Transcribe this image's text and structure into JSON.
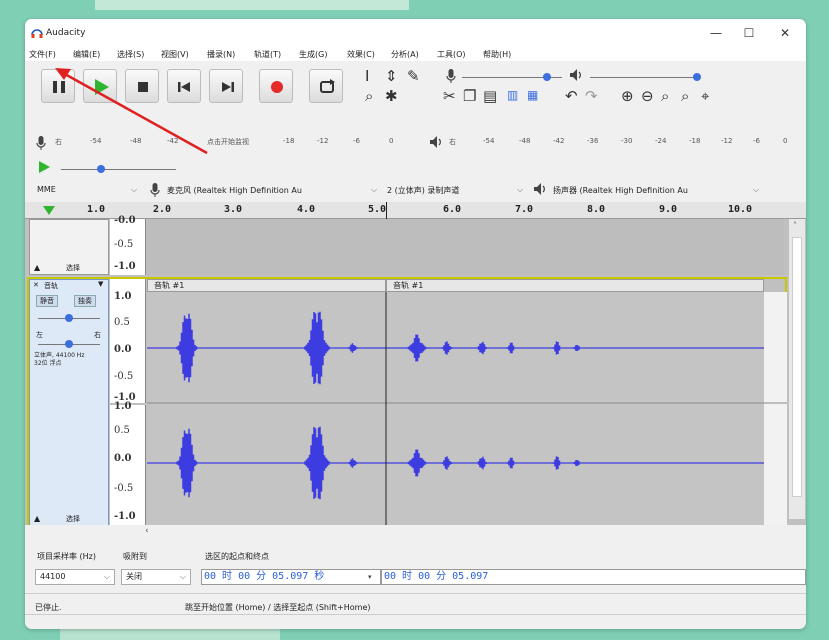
{
  "window": {
    "title": "Audacity",
    "minimize": "—",
    "maximize": "☐",
    "close": "✕"
  },
  "menu": [
    {
      "label": "文件(F)"
    },
    {
      "label": "编辑(E)"
    },
    {
      "label": "选择(S)"
    },
    {
      "label": "视图(V)"
    },
    {
      "label": "播录(N)"
    },
    {
      "label": "轨道(T)"
    },
    {
      "label": "生成(G)"
    },
    {
      "label": "效果(C)"
    },
    {
      "label": "分析(A)"
    },
    {
      "label": "工具(O)"
    },
    {
      "label": "帮助(H)"
    }
  ],
  "transport": {
    "pause_icon": "pause-icon",
    "play_icon": "play-icon",
    "stop_icon": "stop-icon",
    "skip_start_icon": "skip-start-icon",
    "skip_end_icon": "skip-end-icon",
    "record_icon": "record-icon",
    "loop_icon": "loop-icon",
    "record_color": "#e52a2a",
    "play_color": "#2fb52f"
  },
  "meters": {
    "record_scale": [
      "右",
      "-54",
      "-48",
      "-42",
      "点击开始监视",
      "-18",
      "-12",
      "-6",
      "0"
    ],
    "play_scale": [
      "右",
      "-54",
      "-48",
      "-42",
      "-36",
      "-30",
      "-24",
      "-18",
      "-12",
      "-6",
      "0"
    ]
  },
  "device": {
    "host": "MME",
    "mic": "麦克风 (Realtek High Definition Au",
    "channels": "2 (立体声) 录制声道",
    "speaker": "扬声器 (Realtek High Definition Au"
  },
  "ruler": {
    "labels": [
      "1.0",
      "2.0",
      "3.0",
      "4.0",
      "5.0",
      "6.0",
      "7.0",
      "8.0",
      "9.0",
      "10.0"
    ]
  },
  "track1": {
    "scale": [
      "-0.0",
      "-0.5",
      "-1.0"
    ],
    "select_label": "选择"
  },
  "track2": {
    "name": "音轨",
    "mute": "静音",
    "solo": "独奏",
    "pan_left": "左",
    "pan_right": "右",
    "info": "立体声, 44100 Hz\n32位 浮点",
    "select_label": "选择",
    "scale_top": [
      "1.0",
      "0.5",
      "0.0",
      "-0.5",
      "-1.0"
    ],
    "scale_bottom": [
      "1.0",
      "0.5",
      "0.0",
      "-0.5",
      "-1.0"
    ],
    "clip1": "音轨 #1",
    "clip2": "音轨 #1"
  },
  "selection": {
    "rate_label": "项目采样率 (Hz)",
    "snap_label": "吸附到",
    "range_label": "选区的起点和终点",
    "rate_value": "44100",
    "snap_value": "关闭",
    "start_time": "00 时 00 分 05.097 秒",
    "end_time": "00 时 00 分 05.097"
  },
  "status": {
    "state": "已停止.",
    "hint": "跳至开始位置 (Home) / 选择至起点 (Shift+Home)"
  },
  "colors": {
    "waveform": "#3c3ce0",
    "waveform_light": "#6f86f0",
    "annotation_arrow": "#e02020",
    "track_border": "#c8c800"
  }
}
